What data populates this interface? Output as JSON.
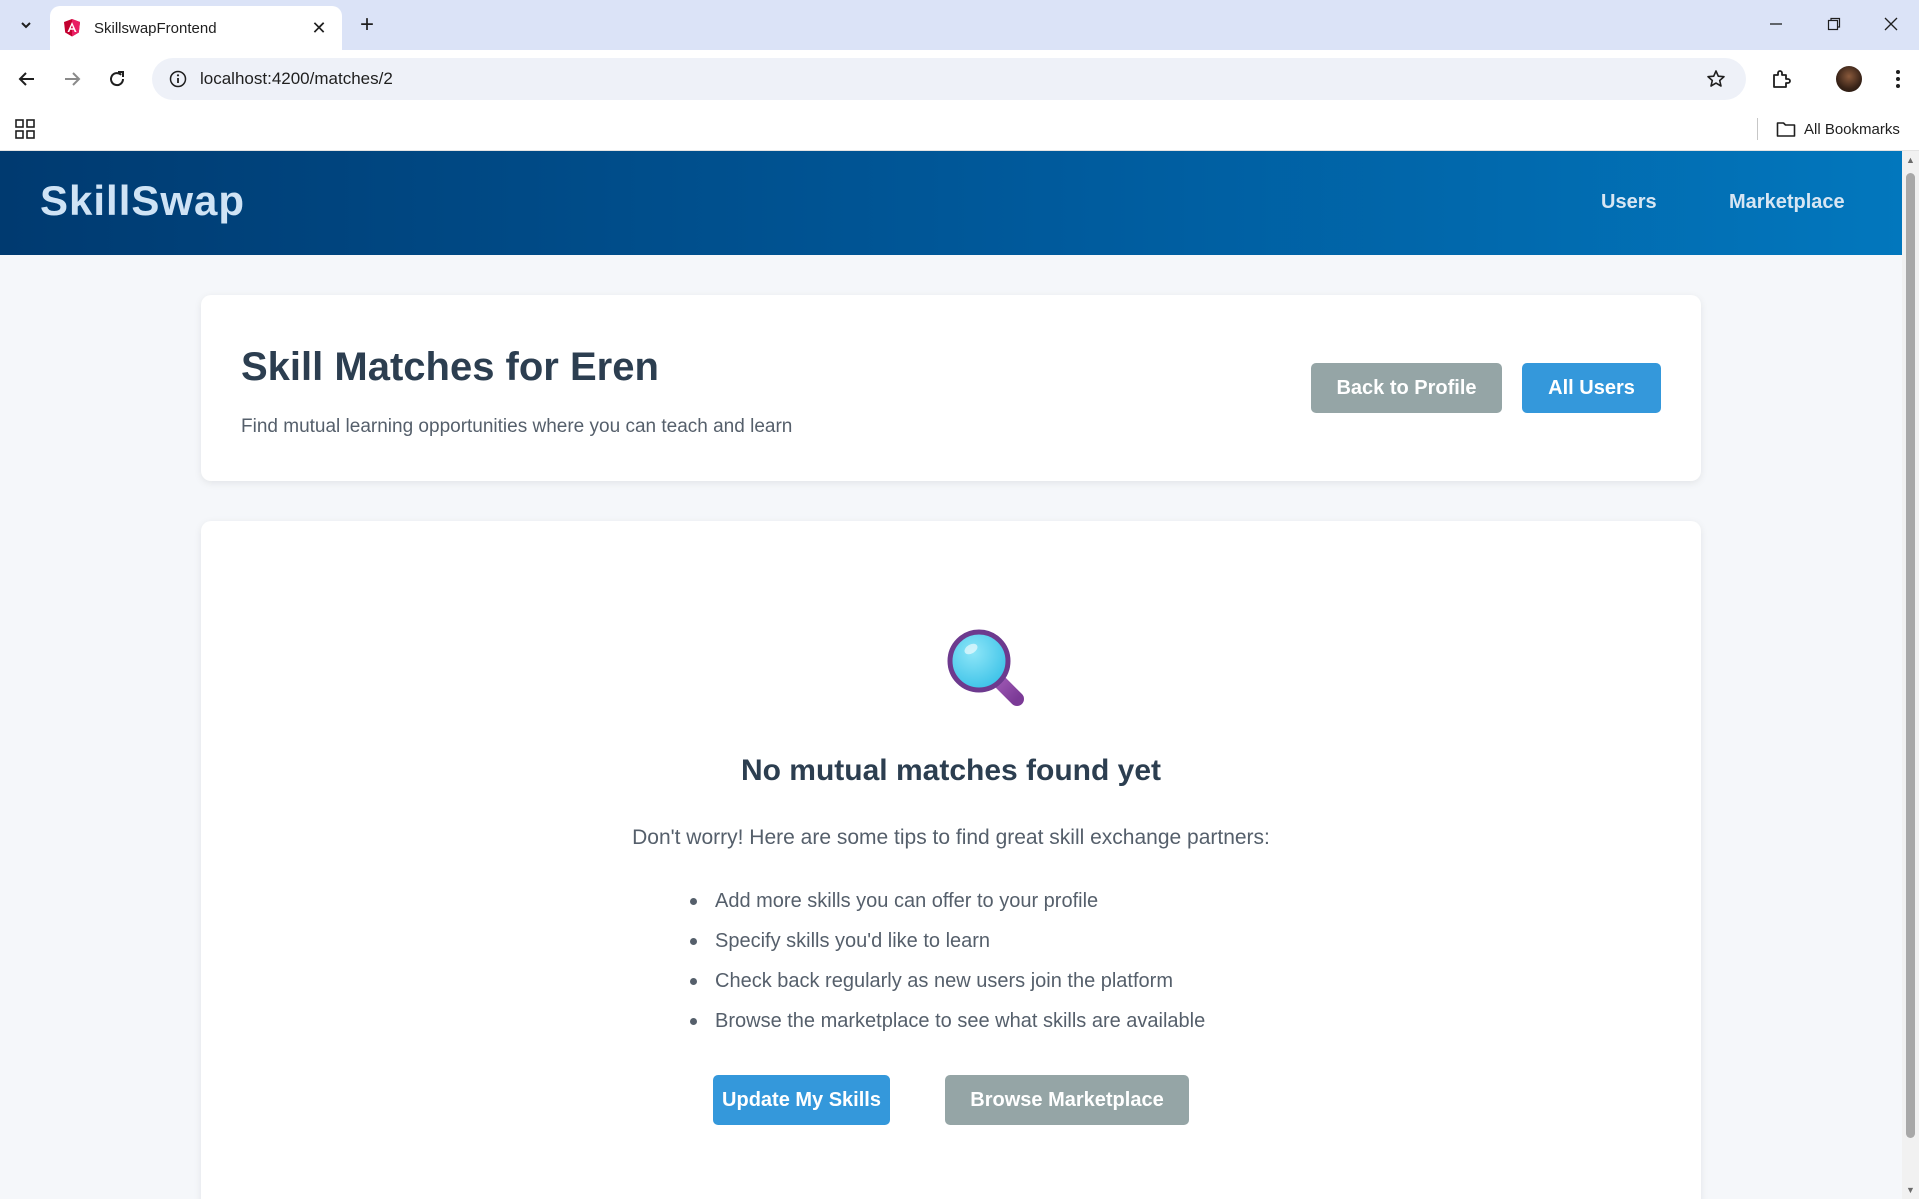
{
  "browser": {
    "tab_title": "SkillswapFrontend",
    "url": "localhost:4200/matches/2",
    "bookmarks_label": "All Bookmarks"
  },
  "header": {
    "brand": "SkillSwap",
    "nav": {
      "users": "Users",
      "marketplace": "Marketplace"
    }
  },
  "page": {
    "title": "Skill Matches for Eren",
    "subtitle": "Find mutual learning opportunities where you can teach and learn",
    "back_button": "Back to Profile",
    "all_users_button": "All Users"
  },
  "empty_state": {
    "icon": "magnifying-glass-icon",
    "title": "No mutual matches found yet",
    "message": "Don't worry! Here are some tips to find great skill exchange partners:",
    "tips": [
      "Add more skills you can offer to your profile",
      "Specify skills you'd like to learn",
      "Check back regularly as new users join the platform",
      "Browse the marketplace to see what skills are available"
    ],
    "update_button": "Update My Skills",
    "browse_button": "Browse Marketplace"
  },
  "colors": {
    "header_start": "#003a70",
    "header_end": "#0277bd",
    "primary_button": "#3498db",
    "secondary_button": "#95a5a6",
    "title_text": "#2c3e50"
  }
}
